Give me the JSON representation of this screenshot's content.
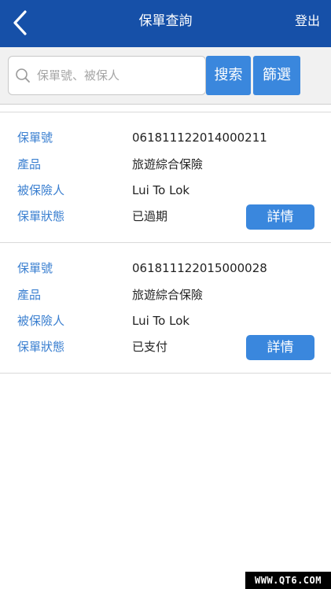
{
  "header": {
    "title": "保單查詢",
    "logout_label": "登出",
    "back_icon": "chevron-left-icon"
  },
  "search": {
    "placeholder": "保單號、被保人",
    "value": "",
    "search_label": "搜索",
    "filter_label": "篩選",
    "icon": "search-icon"
  },
  "labels": {
    "policy_no": "保單號",
    "product": "產品",
    "insured": "被保險人",
    "status": "保單狀態",
    "detail": "詳情"
  },
  "policies": [
    {
      "policy_no": "061811122014000211",
      "product": "旅遊綜合保險",
      "insured": "Lui To Lok",
      "status": "已過期"
    },
    {
      "policy_no": "061811122015000028",
      "product": "旅遊綜合保險",
      "insured": "Lui To Lok",
      "status": "已支付"
    }
  ],
  "watermark": "WWW.QT6.COM",
  "colors": {
    "header": "#1650a8",
    "accent": "#3a87dd",
    "label": "#3a7fd0"
  }
}
